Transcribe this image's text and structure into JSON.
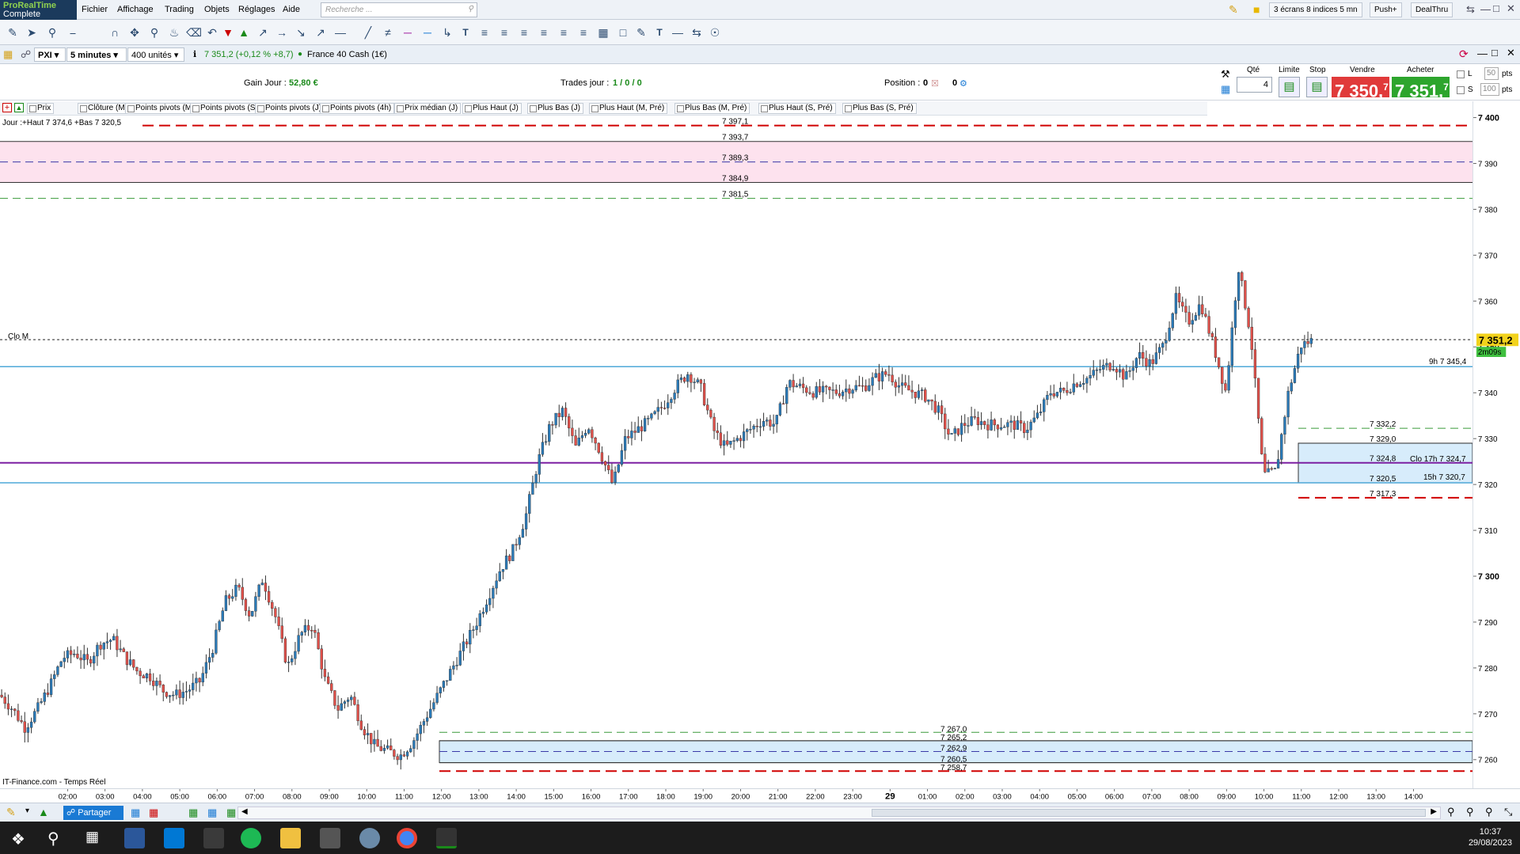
{
  "app": {
    "logo_line1": "ProRealTime",
    "logo_line2": "Complete",
    "menus": [
      "Fichier",
      "Affichage",
      "Trading",
      "Objets",
      "Réglages",
      "Aide"
    ],
    "search_placeholder": "Recherche ...",
    "right_buttons": [
      "3 écrans 8 indices 5 mn",
      "Push+",
      "DealThru"
    ]
  },
  "instrument": {
    "code": "PXI",
    "timeframe": "5 minutes",
    "units": "400 unités",
    "quote": "7 351,2 (+0,12 % +8,7)",
    "name": "France 40 Cash (1€)"
  },
  "info": {
    "gain_label": "Gain Jour :",
    "gain_value": "52,80 €",
    "trades_label": "Trades jour :",
    "trades_value": "1 / 0 / 0",
    "position_label": "Position :",
    "position_value": "0",
    "position_value2": "0"
  },
  "ticket": {
    "qty_label": "Qté",
    "qty_value": "4",
    "limit_label": "Limite",
    "stop_label": "Stop",
    "sell_label": "Vendre",
    "buy_label": "Acheter",
    "sell_price": "7 350,",
    "sell_sup": "7",
    "buy_price": "7 351,",
    "buy_sup": "7",
    "l_label": "L",
    "l_value": "50",
    "s_label": "S",
    "s_value": "100",
    "pts": "pts"
  },
  "indicators": [
    "Prix",
    "Clôture (M)",
    "Points pivots (M)",
    "Points pivots (S)",
    "Points pivots (J)",
    "Points pivots (4h)",
    "Prix médian (J)",
    "Plus Haut (J)",
    "Plus Bas (J)",
    "Plus Haut (M, Pré)",
    "Plus Bas (M, Pré)",
    "Plus Haut (S, Pré)",
    "Plus Bas (S, Pré)"
  ],
  "chart_text": {
    "jour_label": "Jour :+Haut 7 374,6 +Bas 7 320,5",
    "clo_m": "Clo M",
    "source": "IT-Finance.com - Temps Réel",
    "last_price": "7 351,2",
    "countdown": "2m09s",
    "label_9h": "9h 7 345,4",
    "label_clo17": "Clo 17h 7 324,7",
    "label_15h": "15h 7 320,7"
  },
  "levels": {
    "top": [
      "7 397,1",
      "7 393,7",
      "7 389,3",
      "7 384,9",
      "7 381,5"
    ],
    "right": [
      "7 332,2",
      "7 329,0",
      "7 324,8",
      "7 320,5",
      "7 317,3"
    ],
    "bottom": [
      "7 267,0",
      "7 265,2",
      "7 262,9",
      "7 260,5",
      "7 258,7"
    ]
  },
  "chart_data": {
    "type": "candlestick",
    "ylim": [
      7255,
      7404
    ],
    "y_ticks": [
      "7 400",
      "7 390",
      "7 380",
      "7 370",
      "7 360",
      "7 350",
      "7 340",
      "7 330",
      "7 320",
      "7 310",
      "7 300",
      "7 290",
      "7 280",
      "7 270",
      "7 260"
    ],
    "x_ticks": [
      "02:00",
      "03:00",
      "04:00",
      "05:00",
      "06:00",
      "07:00",
      "08:00",
      "09:00",
      "10:00",
      "11:00",
      "12:00",
      "13:00",
      "14:00",
      "15:00",
      "16:00",
      "17:00",
      "18:00",
      "19:00",
      "20:00",
      "21:00",
      "22:00",
      "23:00",
      "29",
      "01:00",
      "02:00",
      "03:00",
      "04:00",
      "05:00",
      "06:00",
      "07:00",
      "08:00",
      "09:00",
      "10:00",
      "11:00",
      "12:00",
      "13:00",
      "14:00"
    ],
    "close_path": [
      [
        0,
        7275
      ],
      [
        1,
        7272
      ],
      [
        2,
        7268
      ],
      [
        3,
        7272
      ],
      [
        4,
        7277
      ],
      [
        5,
        7283
      ],
      [
        6,
        7284
      ],
      [
        7,
        7282
      ],
      [
        8,
        7286
      ],
      [
        9,
        7287
      ],
      [
        10,
        7283
      ],
      [
        11,
        7280
      ],
      [
        12,
        7279
      ],
      [
        13,
        7276
      ],
      [
        14,
        7275
      ],
      [
        15,
        7276
      ],
      [
        16,
        7278
      ],
      [
        17,
        7285
      ],
      [
        18,
        7295
      ],
      [
        19,
        7298
      ],
      [
        20,
        7292
      ],
      [
        21,
        7300
      ],
      [
        22,
        7292
      ],
      [
        23,
        7281
      ],
      [
        24,
        7288
      ],
      [
        25,
        7290
      ],
      [
        26,
        7278
      ],
      [
        27,
        7272
      ],
      [
        28,
        7275
      ],
      [
        29,
        7268
      ],
      [
        30,
        7264
      ],
      [
        31,
        7263
      ],
      [
        32,
        7262
      ],
      [
        33,
        7265
      ],
      [
        34,
        7270
      ],
      [
        35,
        7275
      ],
      [
        36,
        7280
      ],
      [
        37,
        7285
      ],
      [
        38,
        7290
      ],
      [
        39,
        7296
      ],
      [
        40,
        7302
      ],
      [
        41,
        7306
      ],
      [
        42,
        7313
      ],
      [
        43,
        7325
      ],
      [
        44,
        7333
      ],
      [
        45,
        7336
      ],
      [
        46,
        7328
      ],
      [
        47,
        7333
      ],
      [
        48,
        7327
      ],
      [
        49,
        7320
      ],
      [
        50,
        7330
      ],
      [
        51,
        7332
      ],
      [
        52,
        7334
      ],
      [
        53,
        7337
      ],
      [
        54,
        7341
      ],
      [
        55,
        7344
      ],
      [
        56,
        7341
      ],
      [
        57,
        7332
      ],
      [
        58,
        7328
      ],
      [
        59,
        7330
      ],
      [
        60,
        7332
      ],
      [
        61,
        7334
      ],
      [
        62,
        7333
      ],
      [
        63,
        7342
      ],
      [
        64,
        7341
      ],
      [
        65,
        7340
      ],
      [
        66,
        7340
      ],
      [
        67,
        7340
      ],
      [
        68,
        7341
      ],
      [
        69,
        7341
      ],
      [
        70,
        7343
      ],
      [
        71,
        7344
      ],
      [
        72,
        7341
      ],
      [
        73,
        7340
      ],
      [
        74,
        7339
      ],
      [
        75,
        7336
      ],
      [
        76,
        7330
      ],
      [
        77,
        7333
      ],
      [
        78,
        7334
      ],
      [
        79,
        7333
      ],
      [
        80,
        7333
      ],
      [
        81,
        7333
      ],
      [
        82,
        7332
      ],
      [
        83,
        7335
      ],
      [
        84,
        7340
      ],
      [
        85,
        7340
      ],
      [
        86,
        7342
      ],
      [
        87,
        7343
      ],
      [
        88,
        7345
      ],
      [
        89,
        7346
      ],
      [
        90,
        7343
      ],
      [
        91,
        7348
      ],
      [
        92,
        7346
      ],
      [
        93,
        7350
      ],
      [
        94,
        7360
      ],
      [
        95,
        7355
      ],
      [
        96,
        7359
      ],
      [
        97,
        7350
      ],
      [
        98,
        7340
      ],
      [
        99,
        7367
      ],
      [
        100,
        7352
      ],
      [
        101,
        7322
      ],
      [
        102,
        7323
      ],
      [
        103,
        7340
      ],
      [
        104,
        7350
      ],
      [
        105,
        7351.2
      ]
    ]
  },
  "bottom": {
    "share_label": "Partager"
  },
  "taskbar": {
    "time": "10:37",
    "date": "29/08/2023"
  }
}
